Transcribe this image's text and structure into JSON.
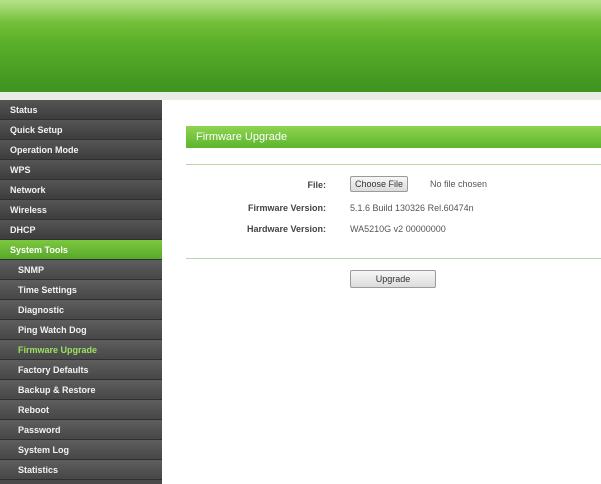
{
  "sidebar": {
    "items": [
      {
        "label": "Status"
      },
      {
        "label": "Quick Setup"
      },
      {
        "label": "Operation Mode"
      },
      {
        "label": "WPS"
      },
      {
        "label": "Network"
      },
      {
        "label": "Wireless"
      },
      {
        "label": "DHCP"
      },
      {
        "label": "System Tools"
      },
      {
        "label": "SNMP"
      },
      {
        "label": "Time Settings"
      },
      {
        "label": "Diagnostic"
      },
      {
        "label": "Ping Watch Dog"
      },
      {
        "label": "Firmware Upgrade"
      },
      {
        "label": "Factory Defaults"
      },
      {
        "label": "Backup & Restore"
      },
      {
        "label": "Reboot"
      },
      {
        "label": "Password"
      },
      {
        "label": "System Log"
      },
      {
        "label": "Statistics"
      }
    ]
  },
  "section": {
    "title": "Firmware Upgrade"
  },
  "form": {
    "file_label": "File:",
    "choose_file_label": "Choose File",
    "file_status": "No file chosen",
    "firmware_label": "Firmware Version:",
    "firmware_value": "5.1.6 Build 130326 Rel.60474n",
    "hardware_label": "Hardware Version:",
    "hardware_value": "WA5210G v2 00000000",
    "upgrade_label": "Upgrade"
  },
  "colors": {
    "accent_green": "#5db52c",
    "sidebar_bg": "#4a4a4a",
    "selected_text": "#9be060"
  }
}
